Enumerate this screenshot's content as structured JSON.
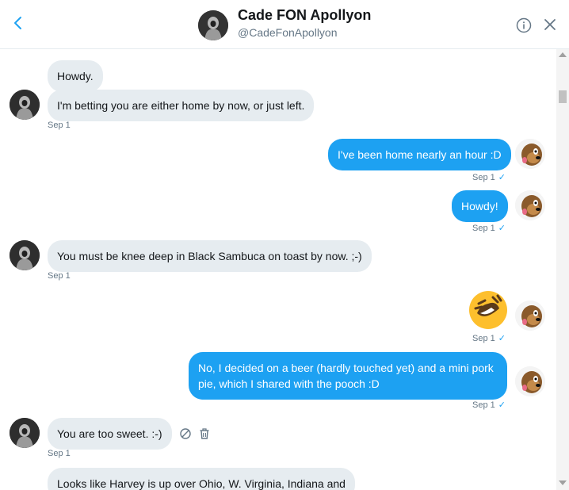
{
  "header": {
    "name": "Cade FON Apollyon",
    "handle": "@CadeFonApollyon",
    "back_icon": "chevron-left-icon",
    "info_icon": "info-icon",
    "close_icon": "close-icon"
  },
  "messages": [
    {
      "direction": "in",
      "text": "Howdy."
    },
    {
      "direction": "in",
      "text": "I'm betting you are either home by now, or just left.",
      "time": "Sep 1"
    },
    {
      "direction": "out",
      "text": "I've been home nearly an hour :D",
      "time": "Sep 1",
      "check": "✓"
    },
    {
      "direction": "out",
      "text": "Howdy!",
      "time": "Sep 1",
      "check": "✓"
    },
    {
      "direction": "in",
      "text": "You must be knee deep in Black Sambuca on toast by now. ;-)",
      "time": "Sep 1"
    },
    {
      "direction": "out",
      "emoji": "rolling-on-floor-laughing-emoji",
      "time": "Sep 1",
      "check": "✓"
    },
    {
      "direction": "out",
      "line1": "No, I decided on a beer (hardly touched yet) and a mini pork",
      "line2": "pie, which I shared with the pooch :D",
      "time": "Sep 1",
      "check": "✓"
    },
    {
      "direction": "in",
      "text": "You are too sweet. :-)",
      "time": "Sep 1",
      "actions": [
        "block-icon",
        "trash-icon"
      ]
    },
    {
      "direction": "in",
      "text": "Looks like Harvey is up over Ohio, W. Virginia, Indiana and"
    }
  ],
  "colors": {
    "incoming_bubble": "#e6ecf0",
    "outgoing_bubble": "#1da1f2",
    "meta_text": "#657786",
    "check": "#1da1f2"
  }
}
